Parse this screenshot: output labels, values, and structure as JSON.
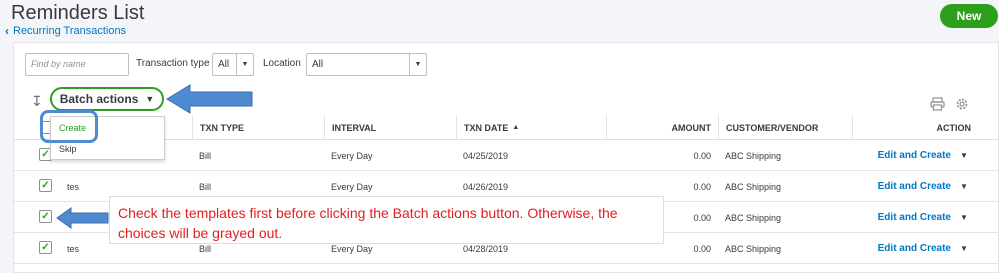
{
  "header": {
    "title": "Reminders List",
    "back_link": "Recurring Transactions",
    "new_button": "New"
  },
  "filters": {
    "search_placeholder": "Find by name",
    "txn_type_label": "Transaction type",
    "txn_type_value": "All",
    "location_label": "Location",
    "location_value": "All"
  },
  "toolbar": {
    "batch_label": "Batch actions",
    "batch_menu": [
      "Create",
      "Skip"
    ]
  },
  "table": {
    "columns": [
      "TXN TYPE",
      "INTERVAL",
      "TXN DATE",
      "AMOUNT",
      "CUSTOMER/VENDOR",
      "ACTION"
    ],
    "txn_date_sort": "▲",
    "rows": [
      {
        "checked": true,
        "name": "",
        "type": "Bill",
        "interval": "Every Day",
        "date": "04/25/2019",
        "amount": "0.00",
        "customer": "ABC Shipping",
        "action": "Edit and Create"
      },
      {
        "checked": true,
        "name": "tes",
        "type": "Bill",
        "interval": "Every Day",
        "date": "04/26/2019",
        "amount": "0.00",
        "customer": "ABC Shipping",
        "action": "Edit and Create"
      },
      {
        "checked": true,
        "name": "",
        "type": "",
        "interval": "",
        "date": "",
        "amount": "0.00",
        "customer": "ABC Shipping",
        "action": "Edit and Create"
      },
      {
        "checked": true,
        "name": "tes",
        "type": "Bill",
        "interval": "Every Day",
        "date": "04/28/2019",
        "amount": "0.00",
        "customer": "ABC Shipping",
        "action": "Edit and Create"
      }
    ]
  },
  "callout": {
    "text": "Check the templates first before clicking the Batch actions button. Otherwise, the choices will be grayed out."
  },
  "colors": {
    "accent_green": "#2ca01c",
    "link_blue": "#0077c5",
    "annotation_blue": "#4f8bd1",
    "annotation_red": "#e02020"
  },
  "icons": [
    "chevron-left-icon",
    "sort-arrow-icon",
    "caret-down-icon",
    "print-icon",
    "gear-icon",
    "check-icon"
  ]
}
